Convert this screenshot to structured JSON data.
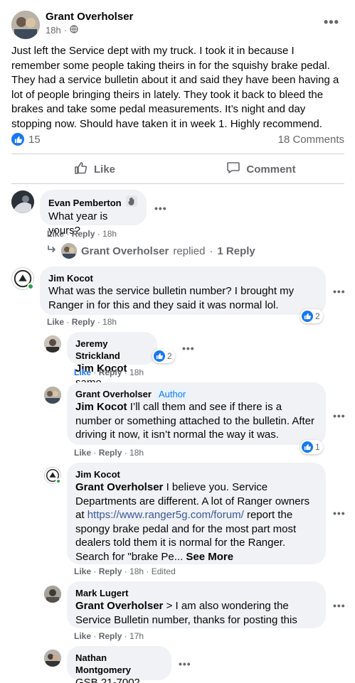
{
  "post": {
    "author": "Grant Overholser",
    "time": "18h",
    "privacy_icon": "globe-icon",
    "text": "Just left the Service dept with my truck. I took it in because I remember some people taking theirs in for the squishy brake pedal. They had a service bulletin about it and said they have been having a lot of people bringing theirs in lately. They took it back to bleed the brakes and take some pedal measurements. It’s night and day stopping now. Should have taken it in week 1. Highly recommend.",
    "reaction_count": "15",
    "comment_count": "18 Comments",
    "like_label": "Like",
    "comment_label": "Comment"
  },
  "colors": {
    "accent": "#1877f2",
    "bubble": "#f0f2f5",
    "meta_text": "#65676b",
    "online": "#31a24c"
  },
  "comments": {
    "c1": {
      "name": "Evan Pemberton",
      "badge_icon": "waving-hand-icon",
      "text": "What year is yours?",
      "like": "Like",
      "reply": "Reply",
      "time": "18h"
    },
    "replied": {
      "name": "Grant Overholser",
      "text": "replied",
      "count": "1 Reply"
    },
    "c2": {
      "name": "Jim Kocot",
      "text": "What was the service bulletin number? I brought my Ranger in for this and they said it was normal lol.",
      "like": "Like",
      "reply": "Reply",
      "time": "18h",
      "reactions": "2"
    },
    "r1": {
      "name": "Jeremy Strickland",
      "mention": "Jim Kocot",
      "text": "same",
      "like": "Like",
      "reply": "Reply",
      "time": "18h",
      "reactions": "2"
    },
    "r2": {
      "name": "Grant Overholser",
      "author_badge": "Author",
      "mention": "Jim Kocot",
      "text": "I’ll call them and see if there is a number or something attached to the bulletin. After driving it now, it isn’t normal the way it was.",
      "like": "Like",
      "reply": "Reply",
      "time": "18h",
      "reactions": "1"
    },
    "r3": {
      "name": "Jim Kocot",
      "mention": "Grant Overholser",
      "text1": "I believe you. Service Departments are different. A lot of Ranger owners at",
      "link": "https://www.ranger5g.com/forum/",
      "text2": "report the spongy brake pedal and for the most part most dealers told them it is normal for the Ranger. Search for \"brake Pe...",
      "see_more": "See More",
      "like": "Like",
      "reply": "Reply",
      "time": "18h",
      "edited": "Edited"
    },
    "r4": {
      "name": "Mark Lugert",
      "mention": "Grant Overholser",
      "text": "> I am also wondering the Service Bulletin number, thanks for posting this",
      "like": "Like",
      "reply": "Reply",
      "time": "17h"
    },
    "r5": {
      "name": "Nathan Montgomery",
      "text": "GSB 21-7002"
    }
  }
}
